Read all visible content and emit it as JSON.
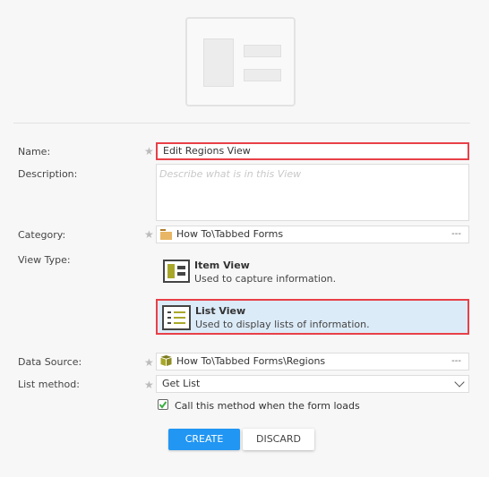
{
  "form": {
    "name": {
      "label": "Name:",
      "value": "Edit Regions View"
    },
    "description": {
      "label": "Description:",
      "placeholder": "Describe what is in this View"
    },
    "category": {
      "label": "Category:",
      "value": "How To\\Tabbed Forms",
      "browse": "---",
      "icon": "folder-icon"
    },
    "view_type": {
      "label": "View Type:",
      "options": [
        {
          "title": "Item View",
          "desc": "Used to capture information.",
          "icon": "item-view-icon",
          "selected": false
        },
        {
          "title": "List View",
          "desc": "Used to display lists of information.",
          "icon": "list-view-icon",
          "selected": true
        }
      ]
    },
    "data_source": {
      "label": "Data Source:",
      "value": "How To\\Tabbed Forms\\Regions",
      "browse": "---",
      "icon": "smartobject-icon"
    },
    "list_method": {
      "label": "List method:",
      "value": "Get List"
    },
    "call_on_load": {
      "label": "Call this method when the form loads",
      "checked": true
    },
    "required_marker": "★"
  },
  "buttons": {
    "create": "CREATE",
    "discard": "DISCARD"
  },
  "colors": {
    "accent": "#2196f3",
    "highlight": "#e84048",
    "selected_bg": "#dcebf8",
    "olive": "#a9a72a"
  }
}
